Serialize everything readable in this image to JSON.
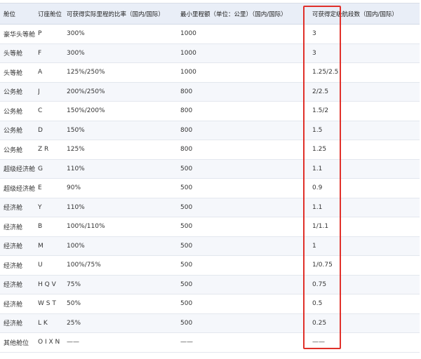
{
  "table": {
    "headers": [
      "舱位",
      "订座舱位",
      "可获得实际里程的比率（国内/国际）",
      "最小里程额（单位：公里）（国内/国际）",
      "可获得定级航段数（国内/国际）"
    ],
    "rows": [
      [
        "豪华头等舱",
        "P",
        "300%",
        "1000",
        "3"
      ],
      [
        "头等舱",
        "F",
        "300%",
        "1000",
        "3"
      ],
      [
        "头等舱",
        "A",
        "125%/250%",
        "1000",
        "1.25/2.5"
      ],
      [
        "公务舱",
        "J",
        "200%/250%",
        "800",
        "2/2.5"
      ],
      [
        "公务舱",
        "C",
        "150%/200%",
        "800",
        "1.5/2"
      ],
      [
        "公务舱",
        "D",
        "150%",
        "800",
        "1.5"
      ],
      [
        "公务舱",
        "Z R",
        "125%",
        "800",
        "1.25"
      ],
      [
        "超级经济舱",
        "G",
        "110%",
        "500",
        "1.1"
      ],
      [
        "超级经济舱",
        "E",
        "90%",
        "500",
        "0.9"
      ],
      [
        "经济舱",
        "Y",
        "110%",
        "500",
        "1.1"
      ],
      [
        "经济舱",
        "B",
        "100%/110%",
        "500",
        "1/1.1"
      ],
      [
        "经济舱",
        "M",
        "100%",
        "500",
        "1"
      ],
      [
        "经济舱",
        "U",
        "100%/75%",
        "500",
        "1/0.75"
      ],
      [
        "经济舱",
        "H Q V",
        "75%",
        "500",
        "0.75"
      ],
      [
        "经济舱",
        "W S T",
        "50%",
        "500",
        "0.5"
      ],
      [
        "经济舱",
        "L K",
        "25%",
        "500",
        "0.25"
      ],
      [
        "其他舱位",
        "O I X N",
        "——",
        "——",
        "——"
      ]
    ]
  },
  "colors": {
    "header_bg": "#e9eef7",
    "stripe_bg": "#f5f7fb",
    "highlight": "#e0302a"
  }
}
